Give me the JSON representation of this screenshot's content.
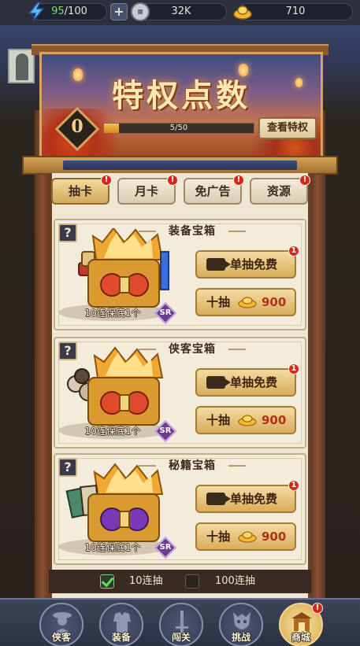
{
  "resources": {
    "energy_current": "95",
    "energy_max": "/100",
    "coins": "32K",
    "gold": "710"
  },
  "banner": {
    "title": "特权点数",
    "level": "0",
    "progress_text": "5/50",
    "progress_fraction": 0.1,
    "view_button": "查看特权"
  },
  "tabs": [
    {
      "label": "抽卡",
      "badge": "!",
      "active": true
    },
    {
      "label": "月卡",
      "badge": "!",
      "active": false
    },
    {
      "label": "免广告",
      "badge": "!",
      "active": false
    },
    {
      "label": "资源",
      "badge": "!",
      "active": false
    }
  ],
  "cards": [
    {
      "title": "装备宝箱",
      "guarantee": "10连保底1个",
      "rarity": "SR",
      "free_label": "单抽免费",
      "free_badge": "1",
      "ten_label": "十抽",
      "price": "900",
      "item_theme": "gold-weapons"
    },
    {
      "title": "侠客宝箱",
      "guarantee": "10连保底1个",
      "rarity": "SR",
      "free_label": "单抽免费",
      "free_badge": "1",
      "ten_label": "十抽",
      "price": "900",
      "item_theme": "heroes"
    },
    {
      "title": "秘籍宝箱",
      "guarantee": "10连保底1个",
      "rarity": "SR",
      "free_label": "单抽免费",
      "free_badge": "1",
      "ten_label": "十抽",
      "price": "900",
      "item_theme": "books"
    }
  ],
  "card_help": "?",
  "multi_draw": {
    "option_10": "10连抽",
    "option_100": "100连抽",
    "selected": "10连抽"
  },
  "nav": [
    {
      "label": "侠客",
      "icon": "hero-icon",
      "active": false
    },
    {
      "label": "装备",
      "icon": "armor-icon",
      "active": false
    },
    {
      "label": "闯关",
      "icon": "sword-icon",
      "active": false
    },
    {
      "label": "挑战",
      "icon": "demon-mask-icon",
      "active": false
    },
    {
      "label": "商城",
      "icon": "shop-icon",
      "active": true,
      "badge": "!"
    }
  ],
  "colors": {
    "accent_gold": "#d9ad5b",
    "badge_red": "#d8261f",
    "price_red": "#b0321c",
    "energy_green": "#6ee36b"
  }
}
